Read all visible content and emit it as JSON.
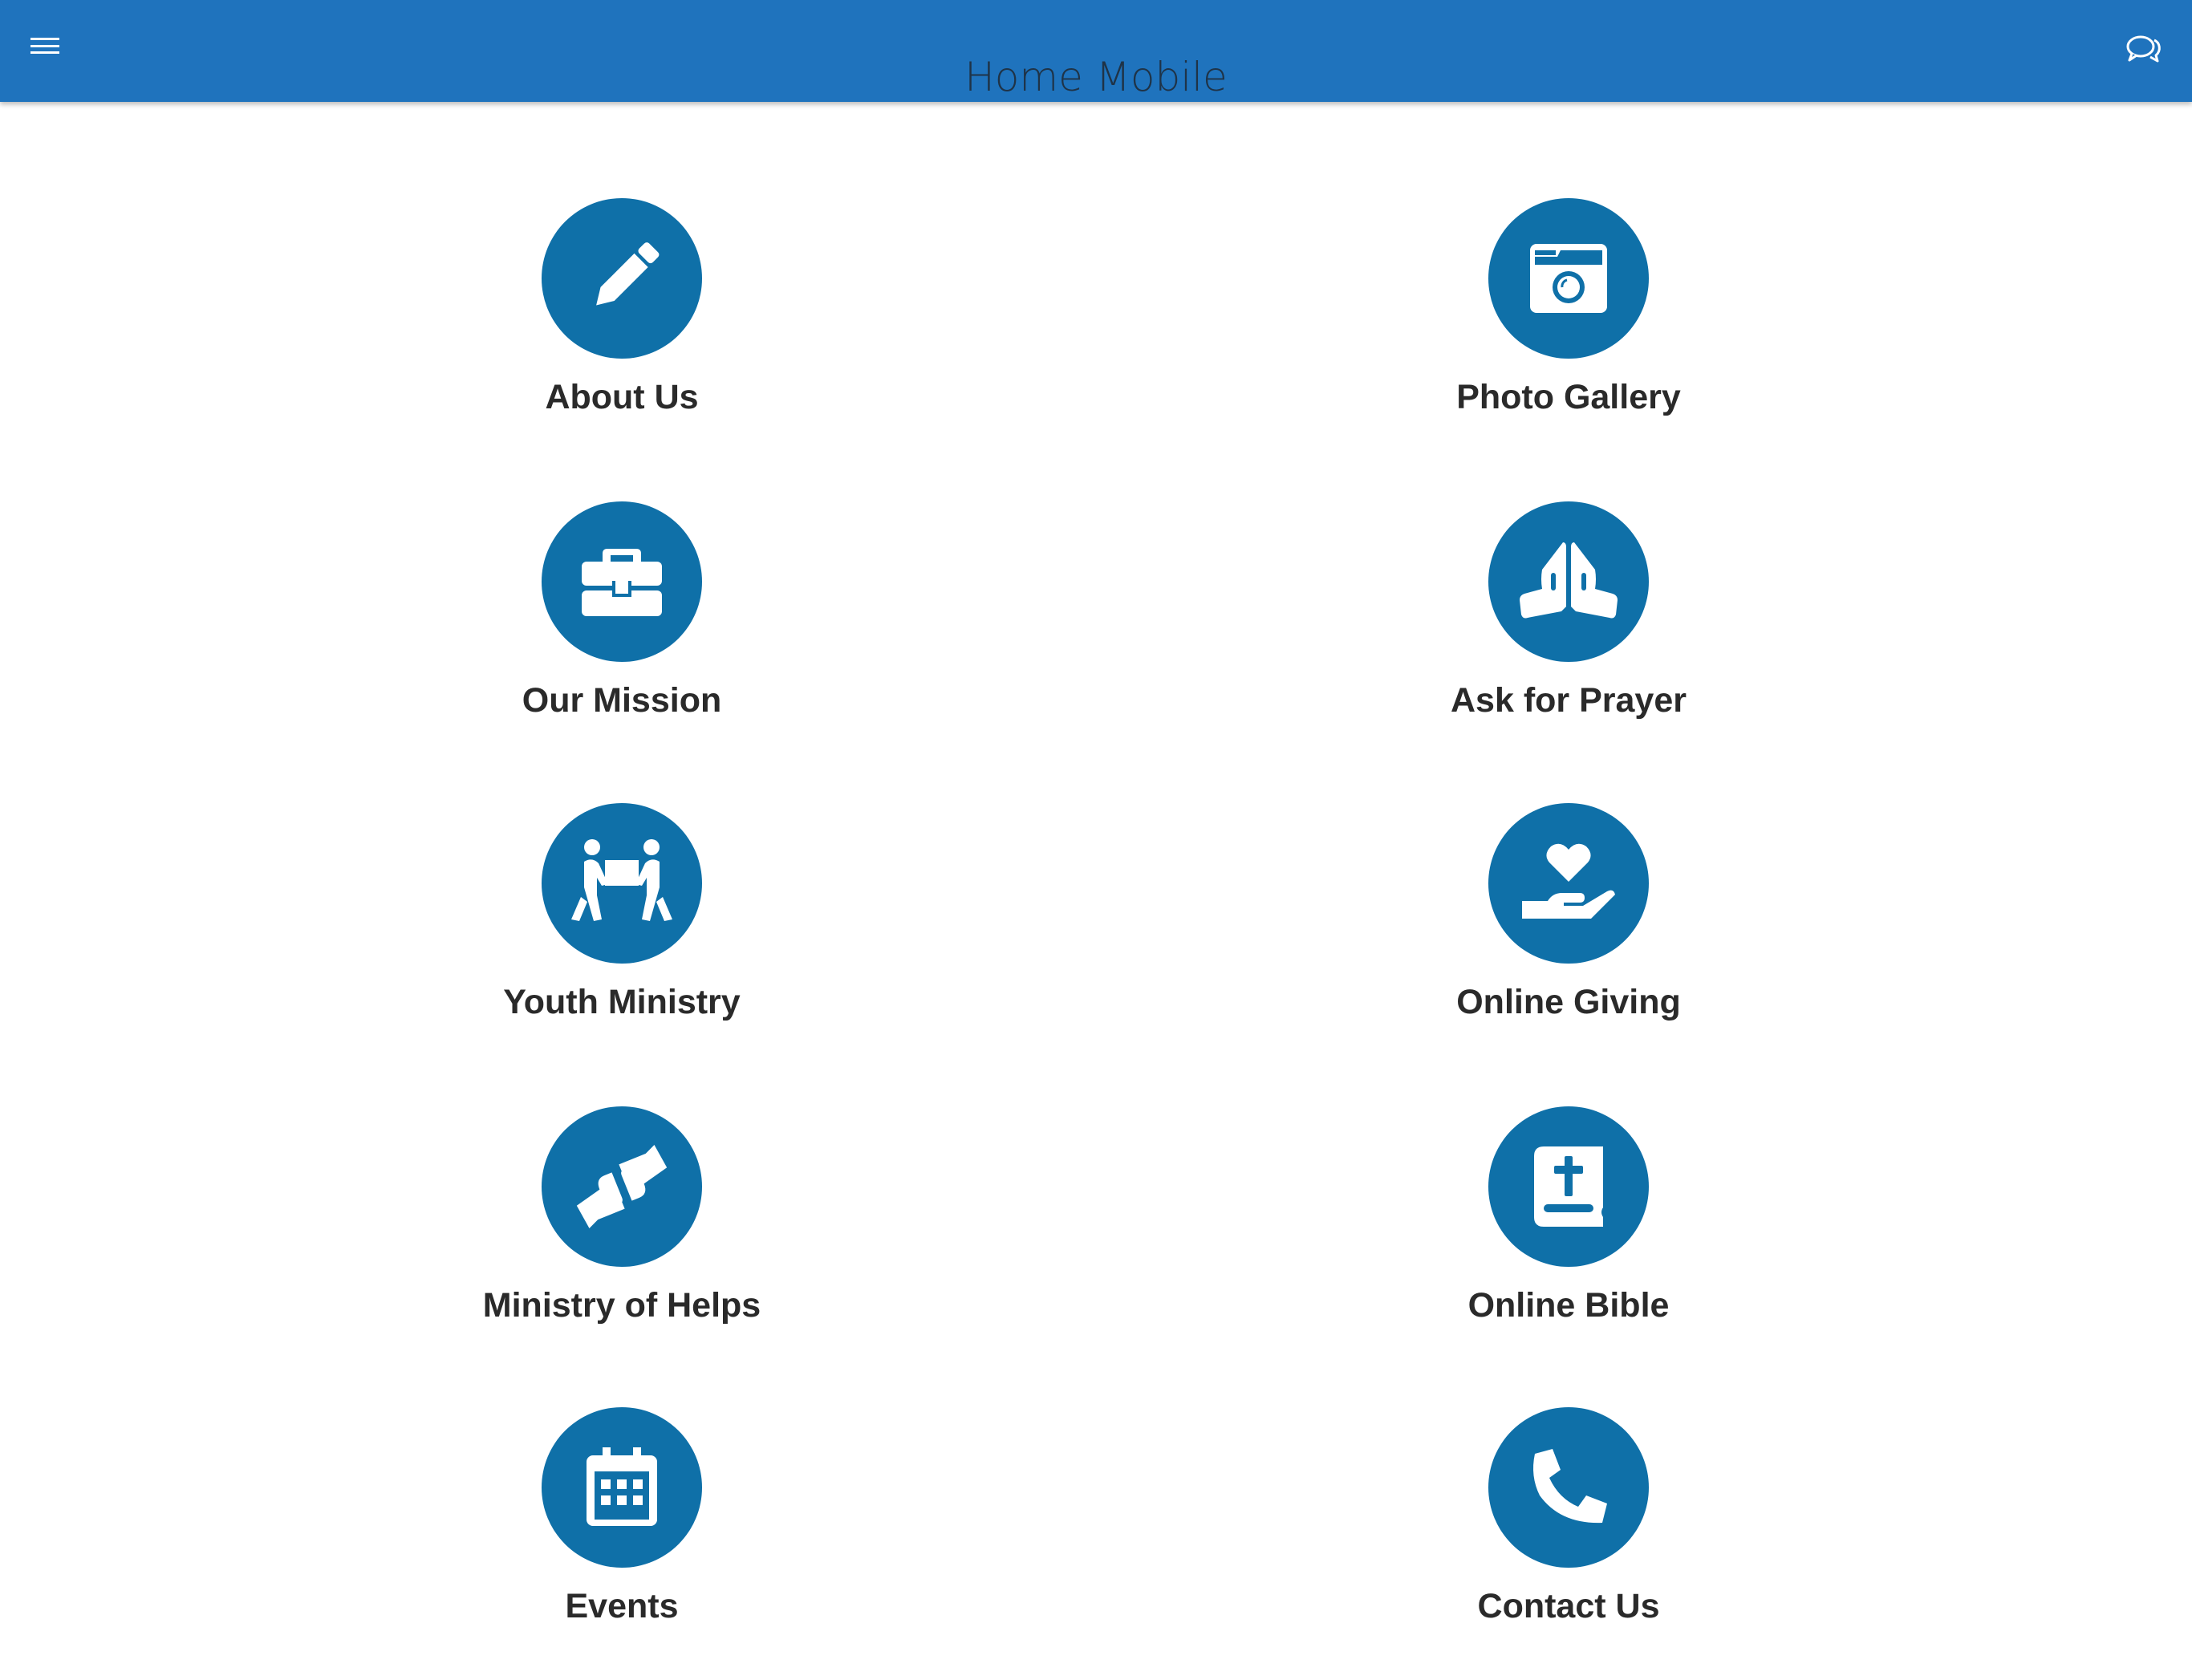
{
  "header": {
    "title": "Home Mobile",
    "menu_icon": "hamburger-menu-icon",
    "chat_icon": "chat-bubbles-icon",
    "background_color": "#1f73bd"
  },
  "accent_color": "#0f70a8",
  "tiles": [
    {
      "label": "About Us",
      "icon": "pencil-icon"
    },
    {
      "label": "Photo Gallery",
      "icon": "camera-icon"
    },
    {
      "label": "Our Mission",
      "icon": "toolbox-icon"
    },
    {
      "label": "Ask for Prayer",
      "icon": "praying-hands-icon"
    },
    {
      "label": "Youth Ministry",
      "icon": "people-carrying-icon"
    },
    {
      "label": "Online Giving",
      "icon": "hand-holding-heart-icon"
    },
    {
      "label": "Ministry of Helps",
      "icon": "handshake-icon"
    },
    {
      "label": "Online Bible",
      "icon": "bible-icon"
    },
    {
      "label": "Events",
      "icon": "calendar-icon"
    },
    {
      "label": "Contact Us",
      "icon": "phone-icon"
    }
  ]
}
